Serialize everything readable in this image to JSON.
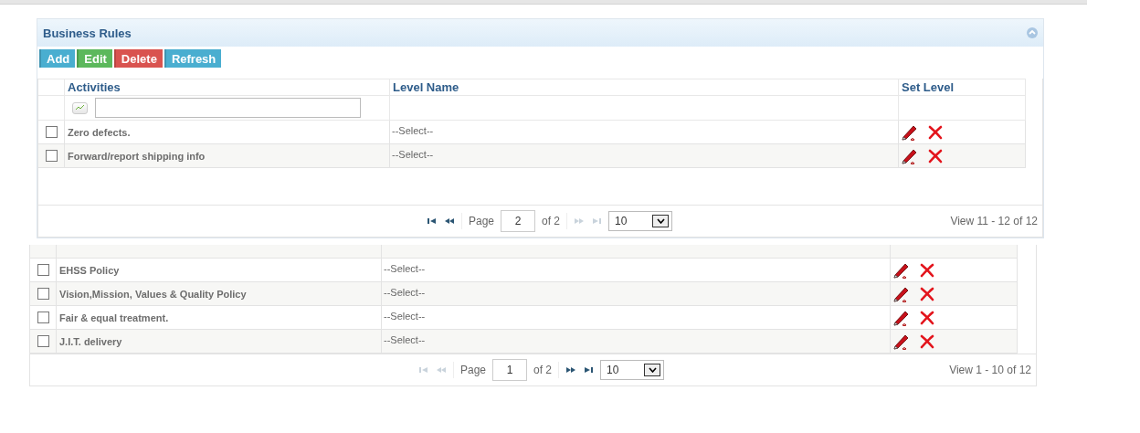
{
  "panel": {
    "title": "Business Rules",
    "collapsed": false,
    "toolbar": [
      {
        "label": "Add",
        "kind": "info"
      },
      {
        "label": "Edit",
        "kind": "success"
      },
      {
        "label": "Delete",
        "kind": "danger"
      },
      {
        "label": "Refresh",
        "kind": "info"
      }
    ],
    "grid": {
      "columns": [
        "Activities",
        "Level Name",
        "Set Level"
      ],
      "rows": [
        {
          "checked": false,
          "activity": "Zero defects.",
          "level_name": "--Select--"
        },
        {
          "checked": false,
          "activity": "Forward/report shipping info",
          "level_name": "--Select--"
        }
      ],
      "pager": {
        "first_disabled": false,
        "prev_disabled": false,
        "page_label": "Page",
        "page": "2",
        "of": "of 2",
        "next_disabled": true,
        "last_disabled": true,
        "page_size": "10",
        "view": "View 11 - 12 of 12"
      }
    }
  },
  "background_grid": {
    "rows": [
      {
        "checked": false,
        "activity": "EHSS Policy",
        "level_name": "--Select--"
      },
      {
        "checked": false,
        "activity": "Vision,Mission, Values & Quality Policy",
        "level_name": "--Select--"
      },
      {
        "checked": false,
        "activity": "Fair & equal treatment.",
        "level_name": "--Select--"
      },
      {
        "checked": false,
        "activity": "J.I.T. delivery",
        "level_name": "--Select--"
      }
    ],
    "pager": {
      "first_disabled": true,
      "prev_disabled": true,
      "page_label": "Page",
      "page": "1",
      "of": "of 2",
      "next_disabled": false,
      "last_disabled": false,
      "page_size": "10",
      "view": "View 1 - 10 of 12"
    }
  }
}
